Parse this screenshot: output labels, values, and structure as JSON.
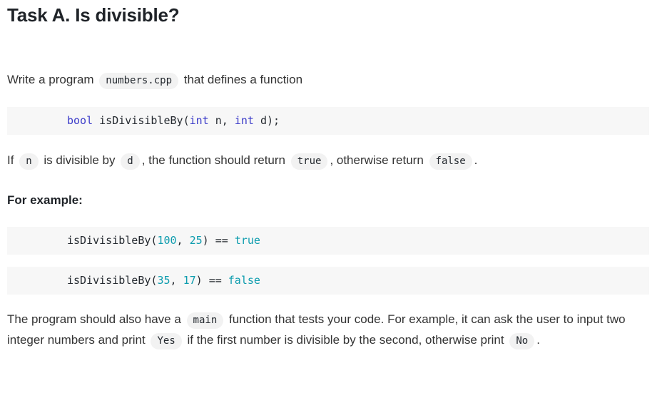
{
  "page": {
    "title": "Task A. Is divisible?"
  },
  "intro": {
    "before": "Write a program",
    "file_code": "numbers.cpp",
    "after": "that defines a function"
  },
  "signature_block": {
    "indent": "",
    "keyword_return": "bool",
    "function_name": "isDivisibleBy",
    "open_paren": "(",
    "keyword_param1_type": "int",
    "param1_name": "n",
    "comma": ",",
    "keyword_param2_type": "int",
    "param2_name": "d",
    "close_paren_semi": ");"
  },
  "if_paragraph": {
    "part1": "If",
    "code_n": "n",
    "part2": "is divisible by",
    "code_d": "d",
    "part3": ", the function should return",
    "code_true": "true",
    "part4": ", otherwise return",
    "code_false": "false",
    "part5": "."
  },
  "subheading": "For example:",
  "examples": [
    {
      "function_name": "isDivisibleBy",
      "open_paren": "(",
      "arg1": "100",
      "comma": ", ",
      "arg2": "25",
      "close_paren": ")",
      "operator": "==",
      "result": "true"
    },
    {
      "function_name": "isDivisibleBy",
      "open_paren": "(",
      "arg1": "35",
      "comma": ", ",
      "arg2": "17",
      "close_paren": ")",
      "operator": "==",
      "result": "false"
    }
  ],
  "final_paragraph": {
    "part1": "The program should also have a",
    "code_main": "main",
    "part2": "function that tests your code. For example, it can ask the user to input two integer numbers and print",
    "code_yes": "Yes",
    "part3": "if the first number is divisible by the second, otherwise print",
    "code_no": "No",
    "part4": "."
  },
  "colors": {
    "text": "#333333",
    "heading": "#1f2328",
    "keyword": "#3b3bc9",
    "literal": "#0d9cae",
    "code_block_bg": "#f7f7f7",
    "inline_code_bg": "#f2f2f2"
  }
}
